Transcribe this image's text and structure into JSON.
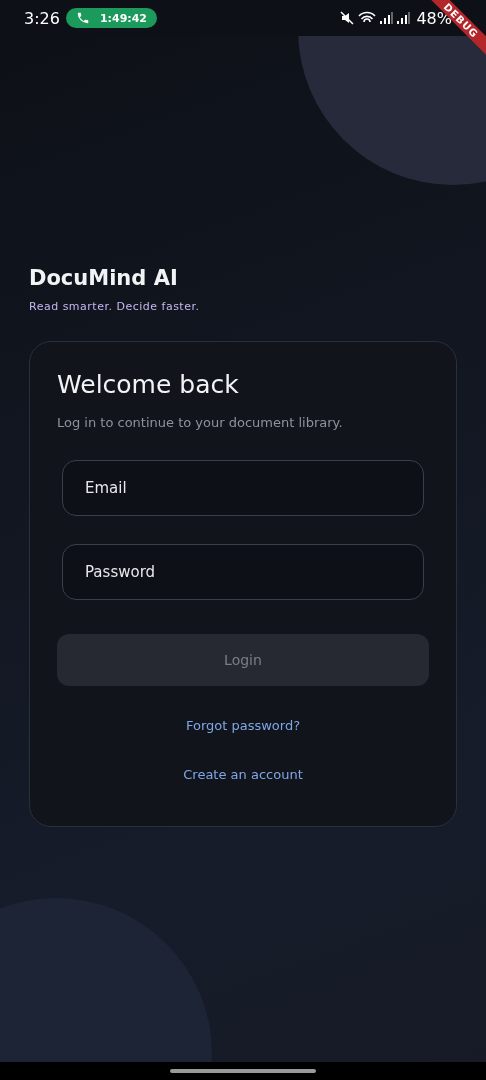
{
  "status_bar": {
    "time": "3:26",
    "call_timer": "1:49:42",
    "battery": "48%",
    "debug_banner": "DEBUG"
  },
  "brand": {
    "title": "DocuMind AI",
    "tagline": "Read smarter. Decide faster."
  },
  "card": {
    "title": "Welcome back",
    "subtitle": "Log in to continue to your document library.",
    "fields": [
      {
        "placeholder": "Email"
      },
      {
        "placeholder": "Password"
      }
    ],
    "login_button": {
      "label": "Login",
      "disabled": true
    },
    "links": [
      "Forgot password?",
      "Create an account"
    ]
  }
}
